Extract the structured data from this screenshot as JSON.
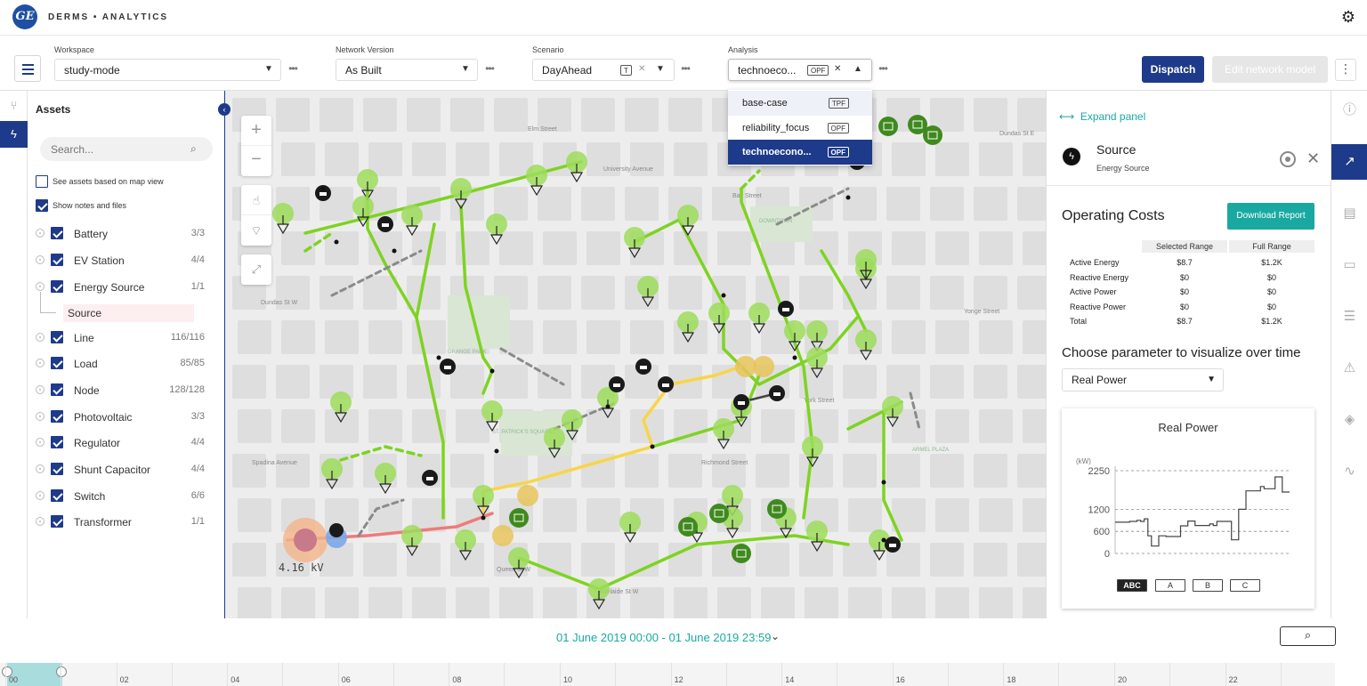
{
  "app": {
    "logo_text": "GE",
    "title": "DERMS • ANALYTICS"
  },
  "toolbar": {
    "workspace": {
      "label": "Workspace",
      "value": "study-mode"
    },
    "network_version": {
      "label": "Network Version",
      "value": "As Built"
    },
    "scenario": {
      "label": "Scenario",
      "value": "DayAhead",
      "tag": "T"
    },
    "analysis": {
      "label": "Analysis",
      "value": "technoeco...",
      "tag": "OPF"
    },
    "more": "•••",
    "dispatch": "Dispatch",
    "edit_network": "Edit network model"
  },
  "analysis_dropdown": [
    {
      "label": "base-case",
      "tag": "TPF",
      "state": "hover"
    },
    {
      "label": "reliability_focus",
      "tag": "OPF",
      "state": "normal"
    },
    {
      "label": "technoecono...",
      "tag": "OPF",
      "state": "selected"
    }
  ],
  "assets_panel": {
    "title": "Assets",
    "search_placeholder": "Search...",
    "see_assets_map_view": "See assets based on map view",
    "show_notes_files": "Show notes and files",
    "items": [
      {
        "name": "Battery",
        "count": "3/3"
      },
      {
        "name": "EV Station",
        "count": "4/4"
      },
      {
        "name": "Energy Source",
        "count": "1/1"
      },
      {
        "name": "Line",
        "count": "116/116"
      },
      {
        "name": "Load",
        "count": "85/85"
      },
      {
        "name": "Node",
        "count": "128/128"
      },
      {
        "name": "Photovoltaic",
        "count": "3/3"
      },
      {
        "name": "Regulator",
        "count": "4/4"
      },
      {
        "name": "Shunt Capacitor",
        "count": "4/4"
      },
      {
        "name": "Switch",
        "count": "6/6"
      },
      {
        "name": "Transformer",
        "count": "1/1"
      }
    ],
    "sub_item": "Source"
  },
  "map": {
    "voltage_label": "4.16 kV",
    "labels": [
      "Dundas St W",
      "Queen St W",
      "Richmond Street",
      "Adelaide St W",
      "Bay Street",
      "York Street",
      "University Avenue",
      "ST. PATRICK'S SQUARE",
      "GRANGE PARK",
      "ARMEL PLAZA",
      "DOWNTOWN",
      "Dundas St E",
      "Elm Street",
      "Yonge Street",
      "Spadina Avenue"
    ]
  },
  "right_panel": {
    "expand_label": "Expand panel",
    "source_title": "Source",
    "source_subtitle": "Energy Source",
    "operating_costs_title": "Operating Costs",
    "download_report": "Download Report",
    "table": {
      "columns": [
        "Selected Range",
        "Full Range"
      ],
      "rows": [
        {
          "label": "Active Energy",
          "selected": "$8.7",
          "full": "$1.2K"
        },
        {
          "label": "Reactive Energy",
          "selected": "$0",
          "full": "$0"
        },
        {
          "label": "Active Power",
          "selected": "$0",
          "full": "$0"
        },
        {
          "label": "Reactive Power",
          "selected": "$0",
          "full": "$0"
        },
        {
          "label": "Total",
          "selected": "$8.7",
          "full": "$1.2K"
        }
      ]
    },
    "choose_param_title": "Choose parameter to visualize over time",
    "param_select": "Real Power",
    "phases": [
      "ABC",
      "A",
      "B",
      "C"
    ]
  },
  "chart_data": {
    "type": "line",
    "title": "Real Power",
    "ylabel": "(kW)",
    "yticks": [
      0,
      600,
      1200,
      2250
    ],
    "ylim": [
      0,
      2250
    ],
    "xlim": [
      0,
      24
    ],
    "x": [
      0,
      2,
      2,
      3,
      3,
      3.5,
      3.5,
      4,
      4,
      4.5,
      4.5,
      5,
      5,
      6,
      6,
      7,
      7,
      9,
      9,
      10,
      10,
      11,
      11,
      13,
      13,
      13.5,
      13.5,
      14,
      14,
      16,
      16,
      17,
      17,
      18,
      18,
      20,
      20,
      20.5,
      20.5,
      22,
      22,
      23,
      23,
      24
    ],
    "y": [
      850,
      850,
      870,
      870,
      900,
      900,
      870,
      870,
      940,
      940,
      480,
      480,
      200,
      200,
      480,
      480,
      460,
      460,
      750,
      750,
      880,
      880,
      760,
      760,
      800,
      800,
      760,
      760,
      870,
      870,
      370,
      370,
      1200,
      1200,
      1700,
      1700,
      1820,
      1820,
      1760,
      1760,
      2080,
      2080,
      1670,
      1670
    ],
    "grid": true,
    "line_color": "#444444"
  },
  "timebar": {
    "range_text": "01 June 2019 00:00 - 01 June 2019 23:59",
    "hours": [
      "00",
      "02",
      "04",
      "06",
      "08",
      "10",
      "12",
      "14",
      "16",
      "18",
      "20",
      "22"
    ]
  },
  "colors": {
    "primary": "#1e3a8a",
    "teal": "#1aa9a2",
    "line_green": "#7ed321",
    "line_yellow": "#f8d548",
    "line_red": "#f07a7a",
    "line_gray": "#8a8a8a"
  }
}
